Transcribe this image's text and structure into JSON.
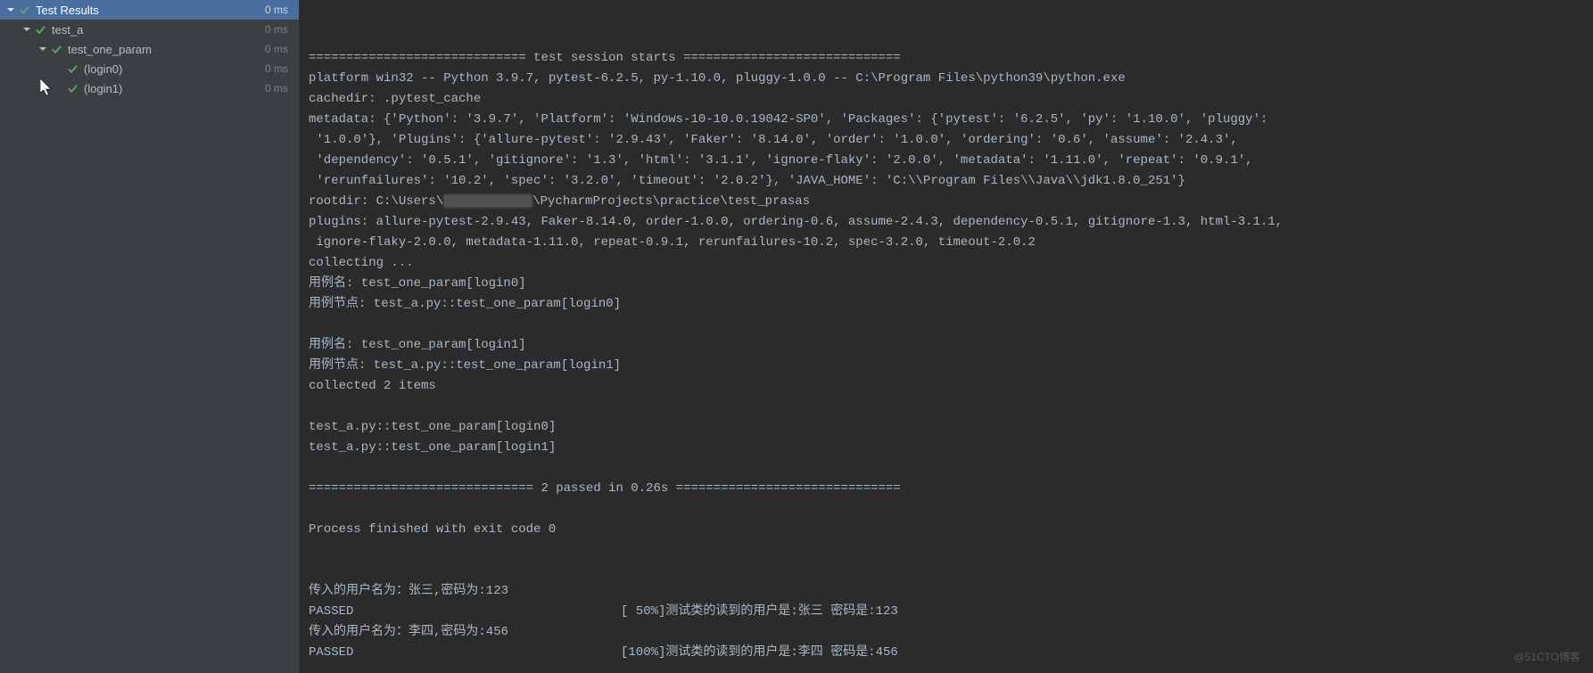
{
  "sidebar": {
    "header": {
      "label": "Test Results",
      "time": "0 ms"
    },
    "items": [
      {
        "label": "test_a",
        "time": "0 ms",
        "indent": 1,
        "hasChevron": true
      },
      {
        "label": "test_one_param",
        "time": "0 ms",
        "indent": 2,
        "hasChevron": true
      },
      {
        "label": "(login0)",
        "time": "0 ms",
        "indent": 3,
        "hasChevron": false
      },
      {
        "label": "(login1)",
        "time": "0 ms",
        "indent": 3,
        "hasChevron": false
      }
    ]
  },
  "console": {
    "lines": [
      "============================= test session starts =============================",
      "platform win32 -- Python 3.9.7, pytest-6.2.5, py-1.10.0, pluggy-1.0.0 -- C:\\Program Files\\python39\\python.exe",
      "cachedir: .pytest_cache",
      "metadata: {'Python': '3.9.7', 'Platform': 'Windows-10-10.0.19042-SP0', 'Packages': {'pytest': '6.2.5', 'py': '1.10.0', 'pluggy':",
      " '1.0.0'}, 'Plugins': {'allure-pytest': '2.9.43', 'Faker': '8.14.0', 'order': '1.0.0', 'ordering': '0.6', 'assume': '2.4.3',",
      " 'dependency': '0.5.1', 'gitignore': '1.3', 'html': '3.1.1', 'ignore-flaky': '2.0.0', 'metadata': '1.11.0', 'repeat': '0.9.1',",
      " 'rerunfailures': '10.2', 'spec': '3.2.0', 'timeout': '2.0.2'}, 'JAVA_HOME': 'C:\\\\Program Files\\\\Java\\\\jdk1.8.0_251'}",
      "rootdir: C:\\Users\\            \\PycharmProjects\\practice\\test_prasas",
      "plugins: allure-pytest-2.9.43, Faker-8.14.0, order-1.0.0, ordering-0.6, assume-2.4.3, dependency-0.5.1, gitignore-1.3, html-3.1.1,",
      " ignore-flaky-2.0.0, metadata-1.11.0, repeat-0.9.1, rerunfailures-10.2, spec-3.2.0, timeout-2.0.2",
      "collecting ...",
      "用例名: test_one_param[login0]",
      "用例节点: test_a.py::test_one_param[login0]",
      "",
      "用例名: test_one_param[login1]",
      "用例节点: test_a.py::test_one_param[login1]",
      "collected 2 items",
      "",
      "test_a.py::test_one_param[login0]",
      "test_a.py::test_one_param[login1]",
      "",
      "============================== 2 passed in 0.26s ==============================",
      "",
      "Process finished with exit code 0"
    ],
    "passed_rows": [
      {
        "left": "传入的用户名为：张三,密码为:123",
        "right": ""
      },
      {
        "left": "PASSED",
        "right": "[ 50%]测试类的读到的用户是:张三 密码是:123"
      },
      {
        "left": "传入的用户名为：李四,密码为:456",
        "right": ""
      },
      {
        "left": "PASSED",
        "right": "[100%]测试类的读到的用户是:李四 密码是:456"
      }
    ]
  },
  "watermark": "@51CTO博客"
}
